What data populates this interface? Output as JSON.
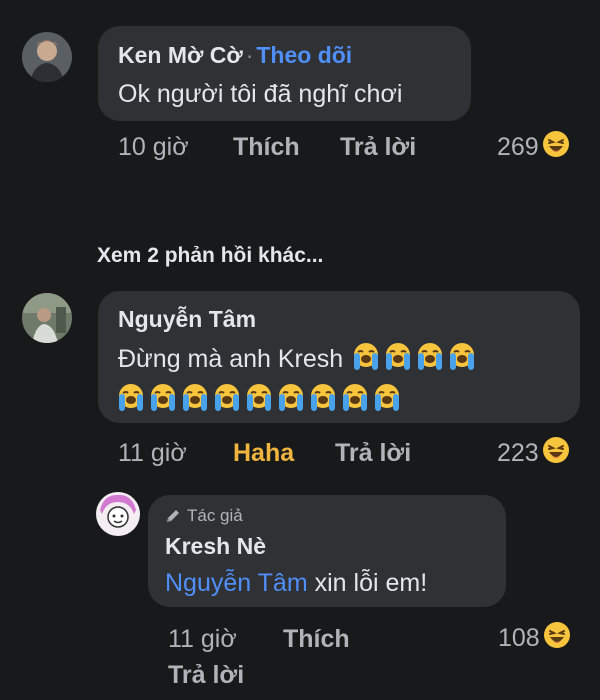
{
  "comments": [
    {
      "author": "Ken Mờ Cờ",
      "follow_label": "Theo dõi",
      "separator": "·",
      "text": "Ok người tôi đã nghĩ chơi",
      "time": "10 giờ",
      "like_label": "Thích",
      "reply_label": "Trả lời",
      "reaction_count": "269",
      "reaction_icon": "haha-emoji-icon"
    },
    {
      "author": "Nguyễn Tâm",
      "text_line1": "Đừng mà anh Kresh",
      "crying_emoji_count_line1": 4,
      "crying_emoji_count_line2": 9,
      "emoji_icon": "loudly-crying-face-icon",
      "time": "11 giờ",
      "reaction_label": "Haha",
      "reaction_label_color": "#f0b53f",
      "reply_label": "Trả lời",
      "reaction_count": "223",
      "reaction_icon": "haha-emoji-icon"
    }
  ],
  "view_more_replies": "Xem 2 phản hồi khác...",
  "reply": {
    "author_tag": "Tác giả",
    "author_tag_icon": "pencil-icon",
    "author": "Kresh Nè",
    "mention": "Nguyễn Tâm",
    "text": "xin lỗi em!",
    "time": "11 giờ",
    "like_label": "Thích",
    "reply_label": "Trả lời",
    "reaction_count": "108",
    "reaction_icon": "haha-emoji-icon"
  },
  "colors": {
    "background": "#18191a",
    "bubble": "#303134",
    "link": "#4f8ff7",
    "muted_text": "#b0b3b8"
  }
}
